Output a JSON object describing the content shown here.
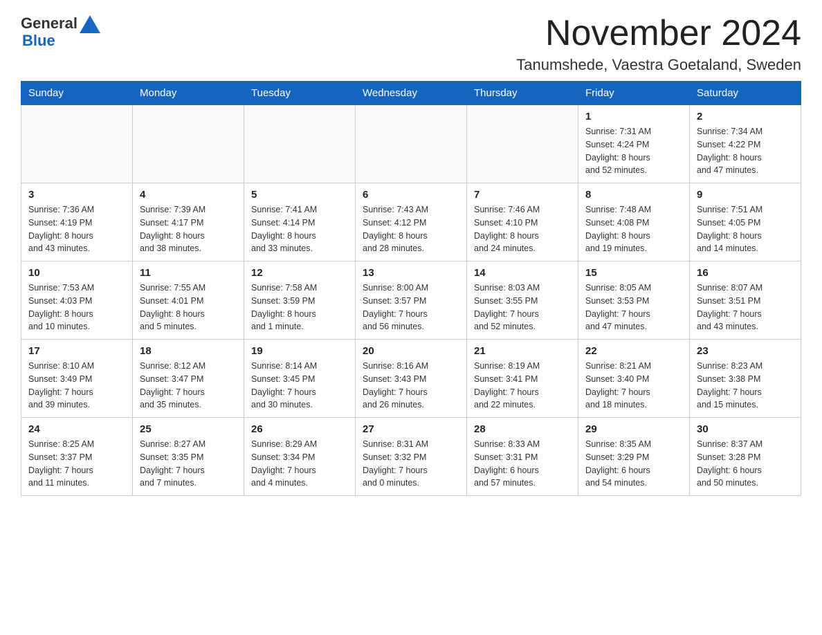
{
  "header": {
    "month_title": "November 2024",
    "location": "Tanumshede, Vaestra Goetaland, Sweden",
    "logo_general": "General",
    "logo_blue": "Blue"
  },
  "days_of_week": [
    "Sunday",
    "Monday",
    "Tuesday",
    "Wednesday",
    "Thursday",
    "Friday",
    "Saturday"
  ],
  "weeks": [
    [
      {
        "day": "",
        "info": ""
      },
      {
        "day": "",
        "info": ""
      },
      {
        "day": "",
        "info": ""
      },
      {
        "day": "",
        "info": ""
      },
      {
        "day": "",
        "info": ""
      },
      {
        "day": "1",
        "info": "Sunrise: 7:31 AM\nSunset: 4:24 PM\nDaylight: 8 hours\nand 52 minutes."
      },
      {
        "day": "2",
        "info": "Sunrise: 7:34 AM\nSunset: 4:22 PM\nDaylight: 8 hours\nand 47 minutes."
      }
    ],
    [
      {
        "day": "3",
        "info": "Sunrise: 7:36 AM\nSunset: 4:19 PM\nDaylight: 8 hours\nand 43 minutes."
      },
      {
        "day": "4",
        "info": "Sunrise: 7:39 AM\nSunset: 4:17 PM\nDaylight: 8 hours\nand 38 minutes."
      },
      {
        "day": "5",
        "info": "Sunrise: 7:41 AM\nSunset: 4:14 PM\nDaylight: 8 hours\nand 33 minutes."
      },
      {
        "day": "6",
        "info": "Sunrise: 7:43 AM\nSunset: 4:12 PM\nDaylight: 8 hours\nand 28 minutes."
      },
      {
        "day": "7",
        "info": "Sunrise: 7:46 AM\nSunset: 4:10 PM\nDaylight: 8 hours\nand 24 minutes."
      },
      {
        "day": "8",
        "info": "Sunrise: 7:48 AM\nSunset: 4:08 PM\nDaylight: 8 hours\nand 19 minutes."
      },
      {
        "day": "9",
        "info": "Sunrise: 7:51 AM\nSunset: 4:05 PM\nDaylight: 8 hours\nand 14 minutes."
      }
    ],
    [
      {
        "day": "10",
        "info": "Sunrise: 7:53 AM\nSunset: 4:03 PM\nDaylight: 8 hours\nand 10 minutes."
      },
      {
        "day": "11",
        "info": "Sunrise: 7:55 AM\nSunset: 4:01 PM\nDaylight: 8 hours\nand 5 minutes."
      },
      {
        "day": "12",
        "info": "Sunrise: 7:58 AM\nSunset: 3:59 PM\nDaylight: 8 hours\nand 1 minute."
      },
      {
        "day": "13",
        "info": "Sunrise: 8:00 AM\nSunset: 3:57 PM\nDaylight: 7 hours\nand 56 minutes."
      },
      {
        "day": "14",
        "info": "Sunrise: 8:03 AM\nSunset: 3:55 PM\nDaylight: 7 hours\nand 52 minutes."
      },
      {
        "day": "15",
        "info": "Sunrise: 8:05 AM\nSunset: 3:53 PM\nDaylight: 7 hours\nand 47 minutes."
      },
      {
        "day": "16",
        "info": "Sunrise: 8:07 AM\nSunset: 3:51 PM\nDaylight: 7 hours\nand 43 minutes."
      }
    ],
    [
      {
        "day": "17",
        "info": "Sunrise: 8:10 AM\nSunset: 3:49 PM\nDaylight: 7 hours\nand 39 minutes."
      },
      {
        "day": "18",
        "info": "Sunrise: 8:12 AM\nSunset: 3:47 PM\nDaylight: 7 hours\nand 35 minutes."
      },
      {
        "day": "19",
        "info": "Sunrise: 8:14 AM\nSunset: 3:45 PM\nDaylight: 7 hours\nand 30 minutes."
      },
      {
        "day": "20",
        "info": "Sunrise: 8:16 AM\nSunset: 3:43 PM\nDaylight: 7 hours\nand 26 minutes."
      },
      {
        "day": "21",
        "info": "Sunrise: 8:19 AM\nSunset: 3:41 PM\nDaylight: 7 hours\nand 22 minutes."
      },
      {
        "day": "22",
        "info": "Sunrise: 8:21 AM\nSunset: 3:40 PM\nDaylight: 7 hours\nand 18 minutes."
      },
      {
        "day": "23",
        "info": "Sunrise: 8:23 AM\nSunset: 3:38 PM\nDaylight: 7 hours\nand 15 minutes."
      }
    ],
    [
      {
        "day": "24",
        "info": "Sunrise: 8:25 AM\nSunset: 3:37 PM\nDaylight: 7 hours\nand 11 minutes."
      },
      {
        "day": "25",
        "info": "Sunrise: 8:27 AM\nSunset: 3:35 PM\nDaylight: 7 hours\nand 7 minutes."
      },
      {
        "day": "26",
        "info": "Sunrise: 8:29 AM\nSunset: 3:34 PM\nDaylight: 7 hours\nand 4 minutes."
      },
      {
        "day": "27",
        "info": "Sunrise: 8:31 AM\nSunset: 3:32 PM\nDaylight: 7 hours\nand 0 minutes."
      },
      {
        "day": "28",
        "info": "Sunrise: 8:33 AM\nSunset: 3:31 PM\nDaylight: 6 hours\nand 57 minutes."
      },
      {
        "day": "29",
        "info": "Sunrise: 8:35 AM\nSunset: 3:29 PM\nDaylight: 6 hours\nand 54 minutes."
      },
      {
        "day": "30",
        "info": "Sunrise: 8:37 AM\nSunset: 3:28 PM\nDaylight: 6 hours\nand 50 minutes."
      }
    ]
  ]
}
